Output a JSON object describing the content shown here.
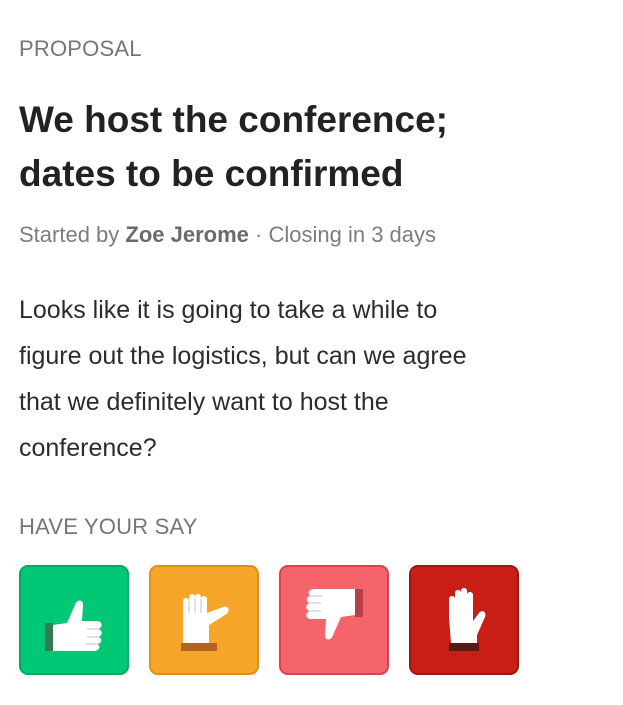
{
  "proposal": {
    "eyebrow": "PROPOSAL",
    "title_lines": [
      "We host the conference;",
      "dates to be confirmed"
    ],
    "meta": {
      "started_by_prefix": "Started by",
      "author": "Zoe Jerome",
      "separator": "·",
      "closing": "Closing in 3 days"
    },
    "description_lines": [
      "Looks like it is going to take a while to",
      "figure out the logistics, but can we agree",
      "that we definitely want to host the",
      "conference?"
    ]
  },
  "vote": {
    "heading": "HAVE YOUR SAY",
    "options": [
      {
        "id": "agree",
        "icon": "thumbs-up-icon",
        "color": "#00c875"
      },
      {
        "id": "abstain",
        "icon": "thumbs-sideways-icon",
        "color": "#f5a62a"
      },
      {
        "id": "disagree",
        "icon": "thumbs-down-icon",
        "color": "#f5636b"
      },
      {
        "id": "block",
        "icon": "raised-hand-icon",
        "color": "#c91e16"
      }
    ]
  }
}
